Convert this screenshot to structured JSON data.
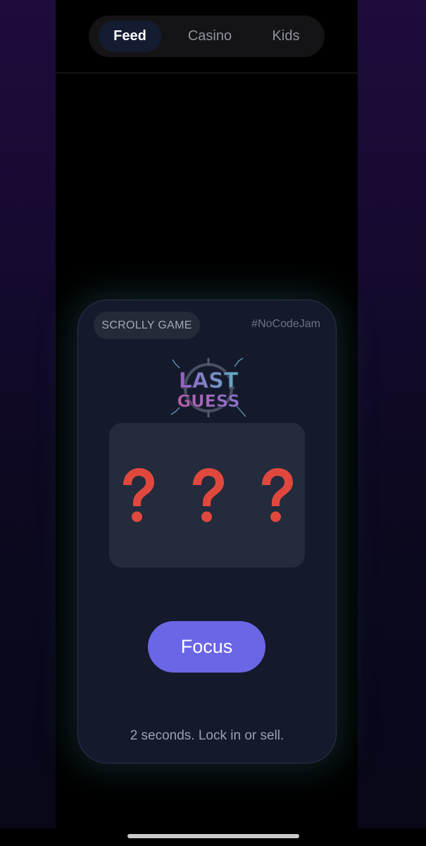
{
  "nav": {
    "tabs": [
      {
        "label": "Feed",
        "active": true
      },
      {
        "label": "Casino",
        "active": false
      },
      {
        "label": "Kids",
        "active": false
      }
    ]
  },
  "card": {
    "badge": "SCROLLY GAME",
    "hashtag": "#NoCodeJam",
    "logo": {
      "line1": "LAST",
      "line2": "GUESS"
    },
    "slots": [
      {
        "icon": "question-mark-icon",
        "symbol": "?"
      },
      {
        "icon": "question-mark-icon",
        "symbol": "?"
      },
      {
        "icon": "question-mark-icon",
        "symbol": "?"
      }
    ],
    "button_label": "Focus",
    "hint": "2 seconds. Lock in or sell."
  },
  "colors": {
    "accent": "#6b66e6",
    "slot_symbol": "#e0483e",
    "card_bg": "#141a2c",
    "active_tab_bg": "#141c31"
  }
}
